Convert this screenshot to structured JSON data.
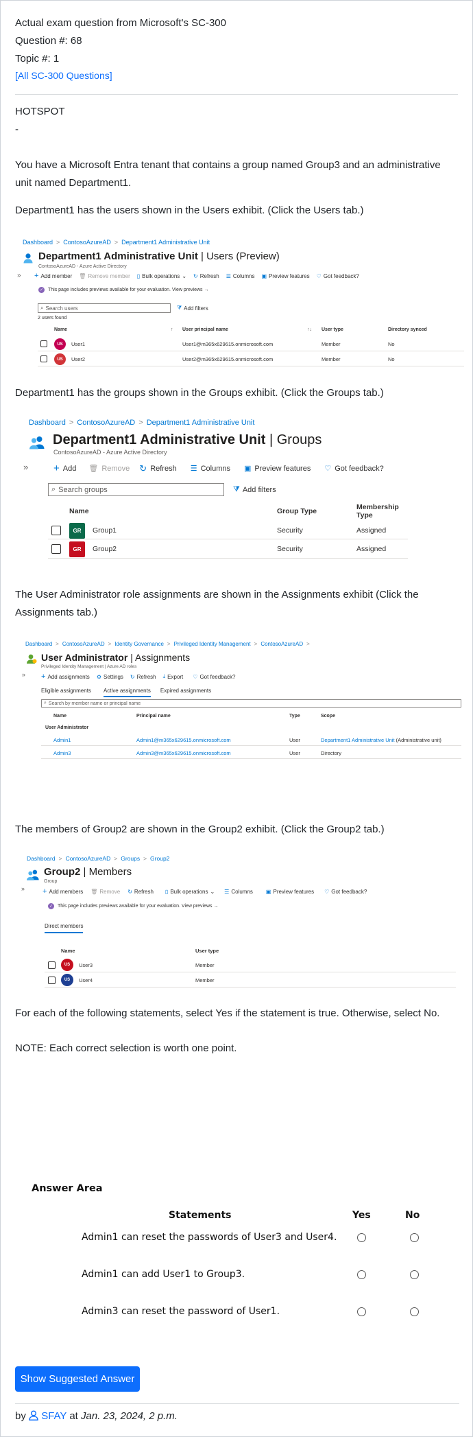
{
  "header": {
    "line1": "Actual exam question from Microsoft's SC-300",
    "line2": "Question #: 68",
    "line3": "Topic #: 1",
    "all_link": "[All SC-300 Questions]"
  },
  "question": {
    "type": "HOTSPOT",
    "dash": "-",
    "intro": "You have a Microsoft Entra tenant that contains a group named Group3 and an administrative unit named Department1.",
    "users_text": "Department1 has the users shown in the Users exhibit. (Click the Users tab.)",
    "groups_text": "Department1 has the groups shown in the Groups exhibit. (Click the Groups tab.)",
    "assign_text": "The User Administrator role assignments are shown in the Assignments exhibit (Click the Assignments tab.)",
    "group2_text": "The members of Group2 are shown in the Group2 exhibit. (Click the Group2 tab.)",
    "instruction": "For each of the following statements, select Yes if the statement is true. Otherwise, select No.",
    "note": "NOTE: Each correct selection is worth one point."
  },
  "users_exhibit": {
    "breadcrumb": [
      "Dashboard",
      "ContosoAzureAD",
      "Department1 Administrative Unit"
    ],
    "title": "Department1 Administrative Unit",
    "title_suffix": "| Users (Preview)",
    "subtitle": "ContosoAzureAD - Azure Active Directory",
    "expand": "»",
    "toolbar": [
      "Add member",
      "Remove member",
      "Bulk operations",
      "Refresh",
      "Columns",
      "Preview features",
      "Got feedback?"
    ],
    "preview_note": "This page includes previews available for your evaluation. View previews →",
    "search_placeholder": "Search users",
    "add_filters": "Add filters",
    "count": "2 users found",
    "columns": [
      "Name",
      "User principal name",
      "User type",
      "Directory synced"
    ],
    "sort_icons": [
      "↑",
      "↑↓"
    ],
    "rows": [
      {
        "initials": "US",
        "name": "User1",
        "upn": "User1@m365x629615.onmicrosoft.com",
        "type": "Member",
        "synced": "No",
        "color": "#c30052"
      },
      {
        "initials": "US",
        "name": "User2",
        "upn": "User2@m365x629615.onmicrosoft.com",
        "type": "Member",
        "synced": "No",
        "color": "#d13438"
      }
    ]
  },
  "groups_exhibit": {
    "breadcrumb": [
      "Dashboard",
      "ContosoAzureAD",
      "Department1 Administrative Unit"
    ],
    "title": "Department1 Administrative Unit",
    "title_suffix": "| Groups",
    "subtitle": "ContosoAzureAD - Azure Active Directory",
    "expand": "»",
    "toolbar": [
      "Add",
      "Remove",
      "Refresh",
      "Columns",
      "Preview features",
      "Got feedback?"
    ],
    "search_placeholder": "Search groups",
    "add_filters": "Add filters",
    "columns": [
      "Name",
      "Group Type",
      "Membership Type"
    ],
    "rows": [
      {
        "initials": "GR",
        "name": "Group1",
        "type": "Security",
        "membership": "Assigned",
        "color": "#0b6a4a"
      },
      {
        "initials": "GR",
        "name": "Group2",
        "type": "Security",
        "membership": "Assigned",
        "color": "#c50f1f"
      }
    ]
  },
  "assign_exhibit": {
    "breadcrumb": [
      "Dashboard",
      "ContosoAzureAD",
      "Identity Governance",
      "Privileged Identity Management",
      "ContosoAzureAD"
    ],
    "title": "User Administrator",
    "title_suffix": "| Assignments",
    "subtitle": "Privileged Identity Management | Azure AD roles",
    "expand": "»",
    "toolbar": [
      "Add assignments",
      "Settings",
      "Refresh",
      "Export",
      "Got feedback?"
    ],
    "tabs": [
      "Eligible assignments",
      "Active assignments",
      "Expired assignments"
    ],
    "search_placeholder": "Search by member name or principal name",
    "columns": [
      "Name",
      "Principal name",
      "Type",
      "Scope"
    ],
    "group_label": "User Administrator",
    "rows": [
      {
        "name": "Admin1",
        "principal": "Admin1@m365x629615.onmicrosoft.com",
        "type": "User",
        "scope_link": "Department1 Administrative Unit",
        "scope_rest": " (Administrative unit)"
      },
      {
        "name": "Admin3",
        "principal": "Admin3@m365x629615.onmicrosoft.com",
        "type": "User",
        "scope_link": "",
        "scope_rest": "Directory"
      }
    ]
  },
  "group2_exhibit": {
    "breadcrumb": [
      "Dashboard",
      "ContosoAzureAD",
      "Groups",
      "Group2"
    ],
    "title": "Group2",
    "title_suffix": "| Members",
    "subtitle": "Group",
    "expand": "»",
    "toolbar": [
      "Add members",
      "Remove",
      "Refresh",
      "Bulk operations",
      "Columns",
      "Preview features",
      "Got feedback?"
    ],
    "preview_note": "This page includes previews available for your evaluation. View previews →",
    "tab": "Direct members",
    "columns": [
      "Name",
      "User type"
    ],
    "rows": [
      {
        "initials": "US",
        "name": "User3",
        "type": "Member",
        "color": "#c50f1f"
      },
      {
        "initials": "US",
        "name": "User4",
        "type": "Member",
        "color": "#1e3f93"
      }
    ]
  },
  "answer_area": {
    "title": "Answer Area",
    "col_statements": "Statements",
    "col_yes": "Yes",
    "col_no": "No",
    "statements": [
      "Admin1 can reset the passwords of User3 and User4.",
      "Admin1 can add User1 to Group3.",
      "Admin3 can reset the password of User1."
    ]
  },
  "footer": {
    "button": "Show Suggested Answer",
    "by": "by",
    "author": "SFAY",
    "at": "at",
    "date": "Jan. 23, 2024, 2 p.m."
  },
  "colors": {
    "link": "#0d6efd",
    "azure_blue": "#0078d4",
    "button": "#0d6efd"
  }
}
